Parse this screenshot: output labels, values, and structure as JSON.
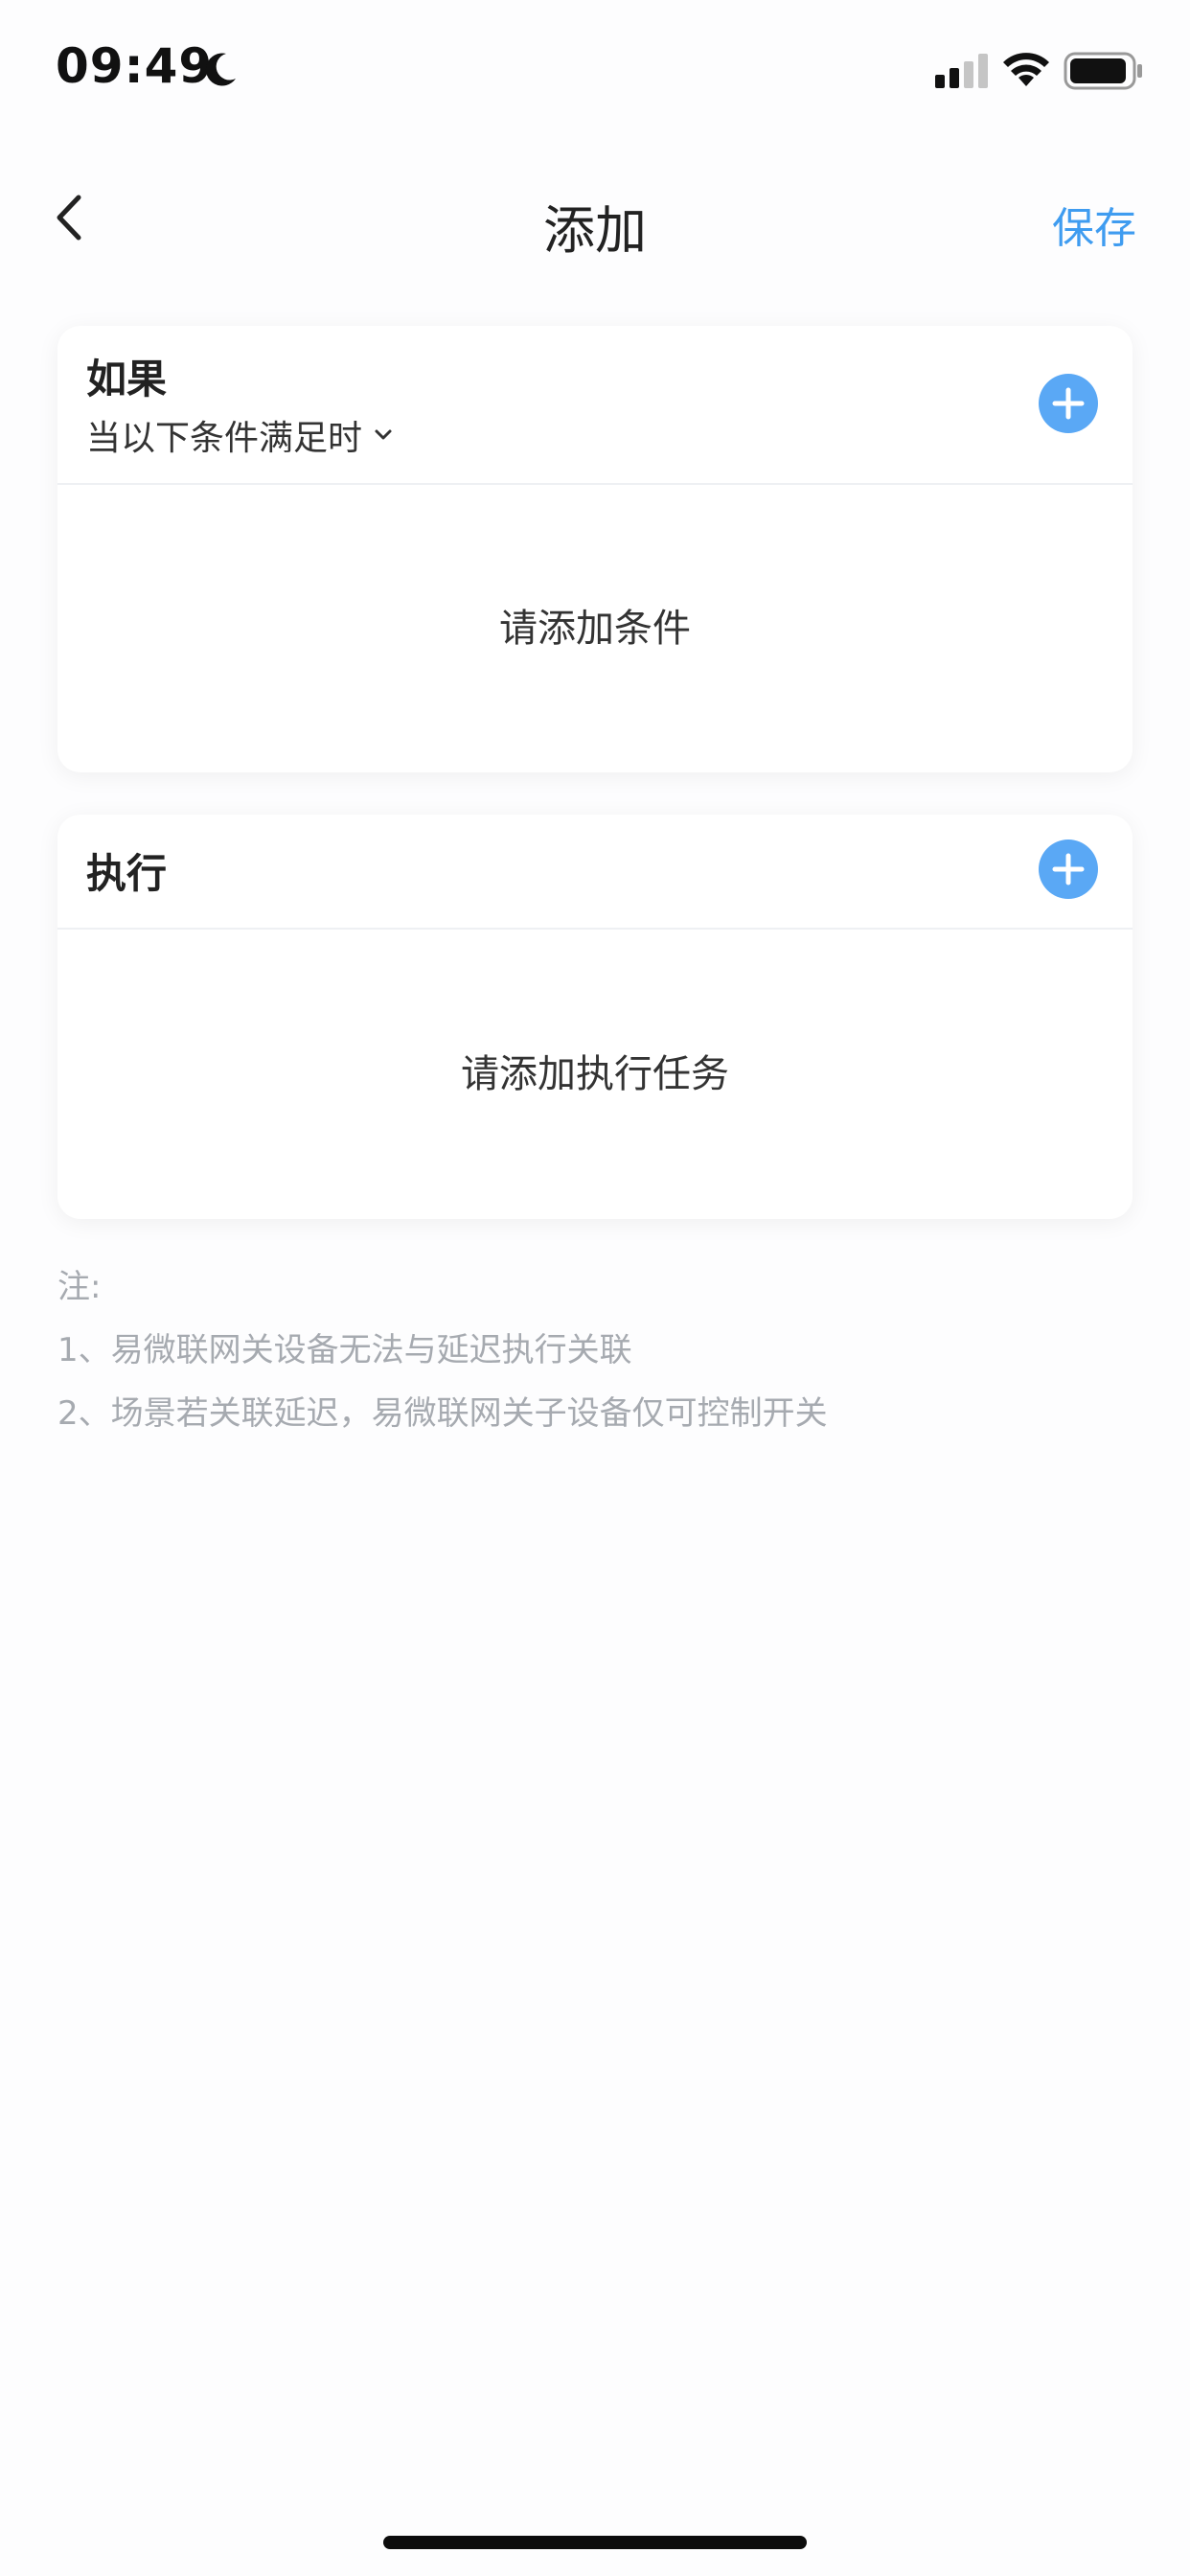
{
  "status_bar": {
    "time": "09:49",
    "icons": [
      "moon-icon",
      "signal-icon",
      "wifi-icon",
      "battery-icon"
    ]
  },
  "nav": {
    "back_icon": "chevron-left-icon",
    "title": "添加",
    "save_label": "保存"
  },
  "condition_card": {
    "title": "如果",
    "subtitle": "当以下条件满足时",
    "subtitle_icon": "chevron-down-icon",
    "add_icon": "plus-circle-icon",
    "empty_text": "请添加条件"
  },
  "action_card": {
    "title": "执行",
    "add_icon": "plus-circle-icon",
    "empty_text": "请添加执行任务"
  },
  "notes": {
    "heading": "注:",
    "items": [
      "1、易微联网关设备无法与延迟执行关联",
      "2、场景若关联延迟，易微联网关子设备仅可控制开关"
    ]
  },
  "colors": {
    "accent": "#3f9cf0",
    "add_button": "#5aa8f5",
    "note_text": "#a6aab0"
  }
}
